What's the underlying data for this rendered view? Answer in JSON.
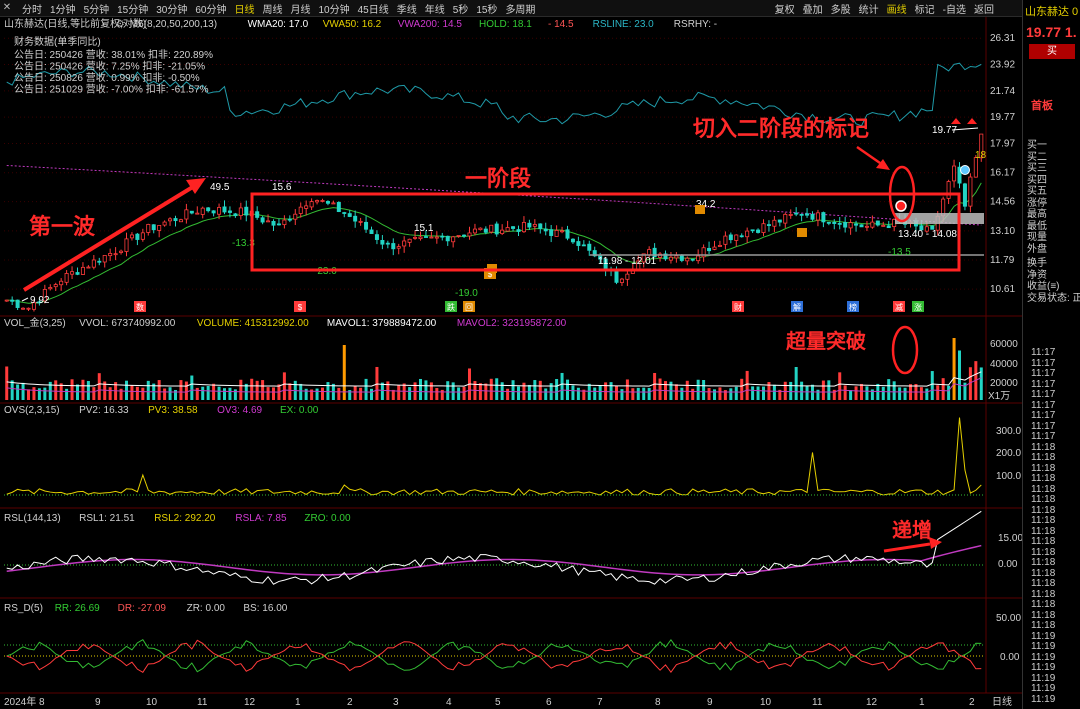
{
  "toolbar": {
    "close_glyph": "✕",
    "periods": [
      "分时",
      "1分钟",
      "5分钟",
      "15分钟",
      "30分钟",
      "60分钟",
      "日线",
      "周线",
      "月线",
      "10分钟",
      "45日线",
      "季线",
      "年线",
      "5秒",
      "15秒",
      "多周期"
    ],
    "active_period": "日线",
    "right_items": [
      "复权",
      "叠加",
      "多股",
      "统计",
      "画线",
      "标记",
      "-自选",
      "返回"
    ],
    "active_right": "画线"
  },
  "main_legend": [
    {
      "text": "山东赫达(日线,等比前复权,对数)",
      "color": "#d0d0d0"
    },
    {
      "text": "⚙",
      "color": "#bbbbbb"
    },
    {
      "text": "M6(8,20,50,200,13)",
      "color": "#d0d0d0"
    },
    {
      "text": "WMA20: 17.0",
      "color": "#ffffff"
    },
    {
      "text": "VWA50: 16.2",
      "color": "#e5d000"
    },
    {
      "text": "VWA200: 14.5",
      "color": "#d03ad0"
    },
    {
      "text": "HOLD: 18.1",
      "color": "#33cc33"
    },
    {
      "text": "- 14.5",
      "color": "#ff5555"
    },
    {
      "text": "RSLINE: 23.0",
      "color": "#2bb5c5"
    },
    {
      "text": "RSRHY: -",
      "color": "#d0d0d0"
    }
  ],
  "finance": {
    "title": "财务数据(单季同比)",
    "rows": [
      "公告日: 250426   营收: 38.01%   扣非: 220.89%",
      "公告日: 250426   营收: 7.25%   扣非: -21.05%",
      "公告日: 250826   营收: 0.99%   扣非: -0.50%",
      "公告日: 251029   营收: -7.00%   扣非: -61.57%"
    ]
  },
  "price_axis": [
    "26.31",
    "23.92",
    "21.74",
    "19.77",
    "17.97",
    "16.17",
    "14.56",
    "13.10",
    "11.79",
    "10.61"
  ],
  "price_labels": [
    {
      "text": "49.5",
      "color": "#ffffff"
    },
    {
      "text": "15.6",
      "color": "#ffffff"
    },
    {
      "text": "-13.3",
      "color": "#33cc33"
    },
    {
      "text": "15.1",
      "color": "#ffffff"
    },
    {
      "text": "-23.0",
      "color": "#33cc33"
    },
    {
      "text": "34.2",
      "color": "#ffffff"
    },
    {
      "text": "-19.0",
      "color": "#33cc33"
    },
    {
      "text": "-13.5",
      "color": "#33cc33"
    },
    {
      "text": "18",
      "color": "#e5d000"
    },
    {
      "text": "9.92",
      "color": "#ffffff"
    },
    {
      "text": "19.77",
      "color": "#ffffff"
    }
  ],
  "range_labels": {
    "low_box": "11.98 - 12.01",
    "high_box": "13.40 - 14.08"
  },
  "annotations": {
    "wave1": "第一波",
    "stage1": "一阶段",
    "stage2": "切入二阶段的标记",
    "volume_break": "超量突破",
    "increase": "递增"
  },
  "event_tags": [
    "数",
    "$",
    "跌",
    "回",
    "$",
    "财",
    "解",
    "榜",
    "减",
    "涨"
  ],
  "volume": {
    "legend": [
      {
        "text": "VOL_金(3,25)",
        "color": "#d0d0d0"
      },
      {
        "text": "VVOL: 673740992.00",
        "color": "#d0d0d0"
      },
      {
        "text": "VOLUME: 415312992.00",
        "color": "#e5d000"
      },
      {
        "text": "MAVOL1: 379889472.00",
        "color": "#ffffff"
      },
      {
        "text": "MAVOL2: 323195872.00",
        "color": "#d03ad0"
      }
    ],
    "axis": [
      "60000",
      "40000",
      "20000"
    ],
    "unit": "X1万"
  },
  "ovs": {
    "legend": [
      {
        "text": "OVS(2,3,15)",
        "color": "#d0d0d0"
      },
      {
        "text": "PV2: 16.33",
        "color": "#d0d0d0"
      },
      {
        "text": "PV3: 38.58",
        "color": "#e5d000"
      },
      {
        "text": "OV3: 4.69",
        "color": "#d03ad0"
      },
      {
        "text": "EX: 0.00",
        "color": "#33cc33"
      }
    ],
    "axis": [
      "300.0",
      "200.0",
      "100.0"
    ]
  },
  "rsl": {
    "legend": [
      {
        "text": "RSL(144,13)",
        "color": "#d0d0d0"
      },
      {
        "text": "RSL1: 21.51",
        "color": "#d0d0d0"
      },
      {
        "text": "RSL2: 292.20",
        "color": "#e5d000"
      },
      {
        "text": "RSLA: 7.85",
        "color": "#d03ad0"
      },
      {
        "text": "ZRO: 0.00",
        "color": "#33cc33"
      }
    ],
    "axis": [
      "15.00",
      "0.00"
    ]
  },
  "rsd": {
    "legend": [
      {
        "text": "RS_D(5)",
        "color": "#d0d0d0"
      },
      {
        "text": "RR: 26.69",
        "color": "#33cc33"
      },
      {
        "text": "DR: -27.09",
        "color": "#ff5555"
      },
      {
        "text": "ZR: 0.00",
        "color": "#d0d0d0"
      },
      {
        "text": "BS: 16.00",
        "color": "#d0d0d0"
      }
    ],
    "axis": [
      "50.00",
      "0.00"
    ]
  },
  "xaxis": [
    "2024年 8",
    "9",
    "10",
    "11",
    "12",
    "1",
    "2",
    "3",
    "4",
    "5",
    "6",
    "7",
    "8",
    "9",
    "10",
    "11",
    "12",
    "1",
    "2"
  ],
  "xaxis_right": "日线",
  "right_panel": {
    "title": "山东赫达 0",
    "price": "19.77  1.",
    "buy": "买",
    "first": "首板",
    "labels": [
      "买一",
      "买二",
      "买三",
      "买四",
      "买五",
      "涨停",
      "最高",
      "最低",
      "现量",
      "外盘",
      "换手",
      "净资",
      "收益(≡)",
      "交易状态: 正"
    ],
    "times": [
      "11:17",
      "11:17",
      "11:17",
      "11:17",
      "11:17",
      "11:17",
      "11:17",
      "11:17",
      "11:17",
      "11:18",
      "11:18",
      "11:18",
      "11:18",
      "11:18",
      "11:18",
      "11:18",
      "11:18",
      "11:18",
      "11:18",
      "11:18",
      "11:18",
      "11:18",
      "11:18",
      "11:18",
      "11:18",
      "11:18",
      "11:18",
      "11:19",
      "11:19",
      "11:19",
      "11:19",
      "11:19",
      "11:19",
      "11:19"
    ]
  },
  "colors": {
    "up": "#ff3b3b",
    "down": "#22d4c4",
    "annotation": "#ff2222",
    "grid": "#3a0000"
  }
}
